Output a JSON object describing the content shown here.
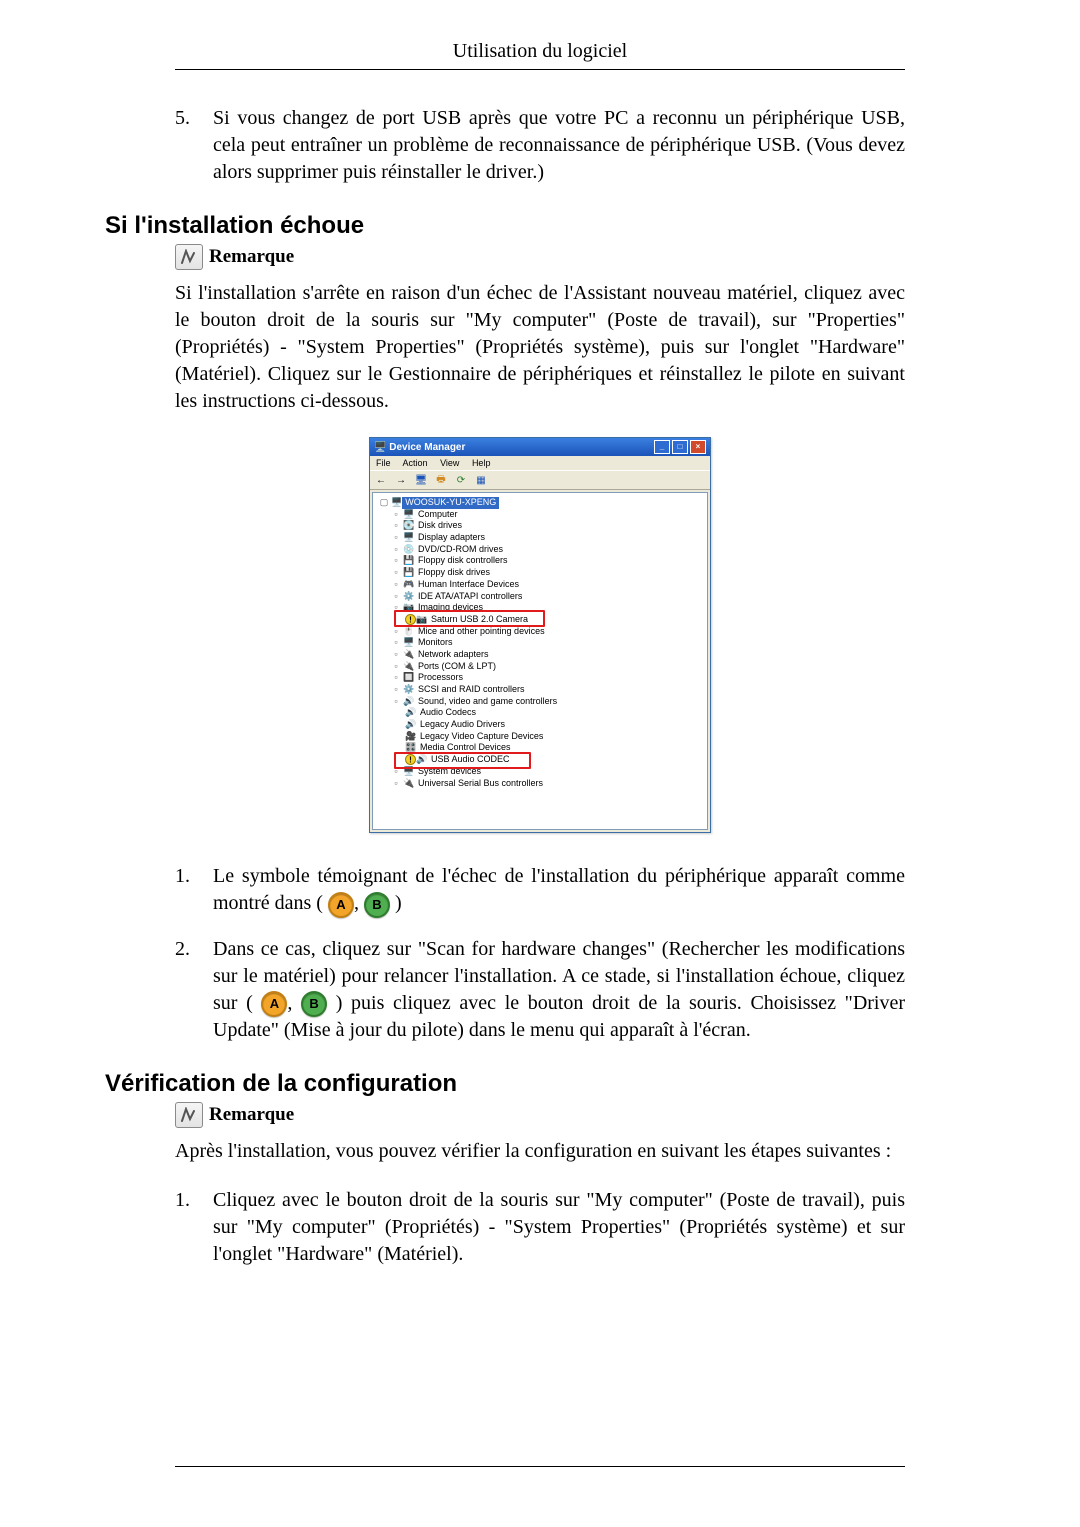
{
  "chapterTitle": "Utilisation du logiciel",
  "introItem": {
    "num": "5.",
    "text": "Si vous changez de port USB après que votre PC a reconnu un périphérique USB, cela peut entraîner un problème de reconnaissance de périphérique USB. (Vous devez alors supprimer puis réinstaller le driver.)"
  },
  "sectionFail": {
    "heading": "Si l'installation échoue",
    "remarkLabel": "Remarque",
    "para": "Si l'installation s'arrête en raison d'un échec de l'Assistant nouveau matériel, cliquez avec le bouton droit de la souris sur \"My computer\" (Poste de travail), sur \"Properties\" (Propriétés) - \"System Properties\" (Propriétés système), puis sur l'onglet \"Hardware\" (Matériel). Cliquez sur le Gestionnaire de périphériques et réinstallez le pilote en suivant les instructions ci-dessous.",
    "step1": {
      "num": "1.",
      "textA": "Le symbole témoignant de l'échec de l'installation du périphérique apparaît comme montré dans (",
      "comma": ", ",
      "textB": ")"
    },
    "step2": {
      "num": "2.",
      "textA": "Dans ce cas, cliquez sur \"Scan for hardware changes\" (Rechercher les modifications sur le matériel) pour relancer l'installation. A ce stade, si l'installation échoue, cliquez sur (",
      "comma": ", ",
      "textB": ") puis cliquez avec le bouton droit de la souris. Choisissez \"Driver Update\" (Mise à jour du pilote) dans le menu qui apparaît à l'écran."
    }
  },
  "badgeA": "A",
  "badgeB": "B",
  "sectionVerify": {
    "heading": "Vérification de la configuration",
    "remarkLabel": "Remarque",
    "para": "Après l'installation, vous pouvez vérifier la configuration en suivant les étapes suivantes :",
    "step1": {
      "num": "1.",
      "text": "Cliquez avec le bouton droit de la souris sur \"My computer\" (Poste de travail), puis sur \"My computer\" (Propriétés) - \"System Properties\" (Propriétés système) et sur l'onglet \"Hardware\" (Matériel)."
    }
  },
  "devmgr": {
    "title": "Device Manager",
    "menu": {
      "file": "File",
      "action": "Action",
      "view": "View",
      "help": "Help"
    },
    "root": "WOOSUK-YU-XPENG",
    "nodes": {
      "computer": "Computer",
      "diskDrives": "Disk drives",
      "displayAdapters": "Display adapters",
      "dvdcd": "DVD/CD-ROM drives",
      "floppyCtrl": "Floppy disk controllers",
      "floppyDrives": "Floppy disk drives",
      "hid": "Human Interface Devices",
      "ide": "IDE ATA/ATAPI controllers",
      "imaging": "Imaging devices",
      "saturn": "Saturn USB 2.0 Camera",
      "mice": "Mice and other pointing devices",
      "monitors": "Monitors",
      "network": "Network adapters",
      "ports": "Ports (COM & LPT)",
      "processors": "Processors",
      "scsi": "SCSI and RAID controllers",
      "sound": "Sound, video and game controllers",
      "audioCodecs": "Audio Codecs",
      "legacyAudio": "Legacy Audio Drivers",
      "legacyVideo": "Legacy Video Capture Devices",
      "mediaCtrl": "Media Control Devices",
      "usbAudio": "USB Audio CODEC",
      "systemDevices": "System devices",
      "usbCtrl": "Universal Serial Bus controllers"
    }
  }
}
